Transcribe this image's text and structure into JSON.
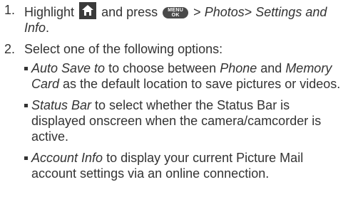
{
  "step1": {
    "number": "1.",
    "text_before_icon": "Highlight",
    "home_icon": "home-icon",
    "text_and_press": "and press",
    "menu_key_top": "MENU",
    "menu_key_bottom": "OK",
    "arrow1": ">",
    "photos": "Photos",
    "arrow2": ">",
    "settings_info": "Settings and Info",
    "period": "."
  },
  "step2": {
    "number": "2.",
    "text": "Select one of the following options:"
  },
  "options": [
    {
      "term": "Auto Save to",
      "pre": " to choose between ",
      "phone": "Phone",
      "and": " and ",
      "memory_card": "Memory Card",
      "rest": " as the default location to save pictures or videos."
    },
    {
      "term": "Status Bar",
      "rest": " to select whether the Status Bar is displayed onscreen when the camera/camcorder is active."
    },
    {
      "term": "Account Info",
      "rest": " to display your current Picture Mail account settings via an online connection."
    }
  ]
}
